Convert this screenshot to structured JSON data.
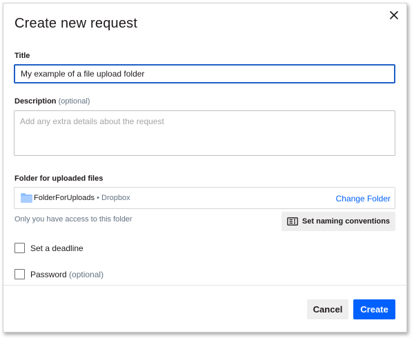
{
  "dialog": {
    "title": "Create new request",
    "close_icon": "close-icon"
  },
  "title_field": {
    "label": "Title",
    "value": "My example of a file upload folder"
  },
  "description_field": {
    "label": "Description",
    "optional": "(optional)",
    "placeholder": "Add any extra details about the request"
  },
  "folder": {
    "label": "Folder for uploaded files",
    "icon": "folder-icon",
    "icon_color": "#8fbfff",
    "name": "FolderForUploads",
    "separator": " • ",
    "location": "Dropbox",
    "change_label": "Change Folder",
    "access_note": "Only you have access to this folder"
  },
  "naming_button": {
    "icon": "naming-conventions-icon",
    "label": "Set naming conventions"
  },
  "options": {
    "deadline_label": "Set a deadline",
    "password_label": "Password",
    "password_optional": "(optional)"
  },
  "footer": {
    "cancel_label": "Cancel",
    "create_label": "Create"
  },
  "colors": {
    "accent": "#0061fe",
    "focus_border": "#1f5fc7",
    "secondary_button": "#eeeeee"
  }
}
